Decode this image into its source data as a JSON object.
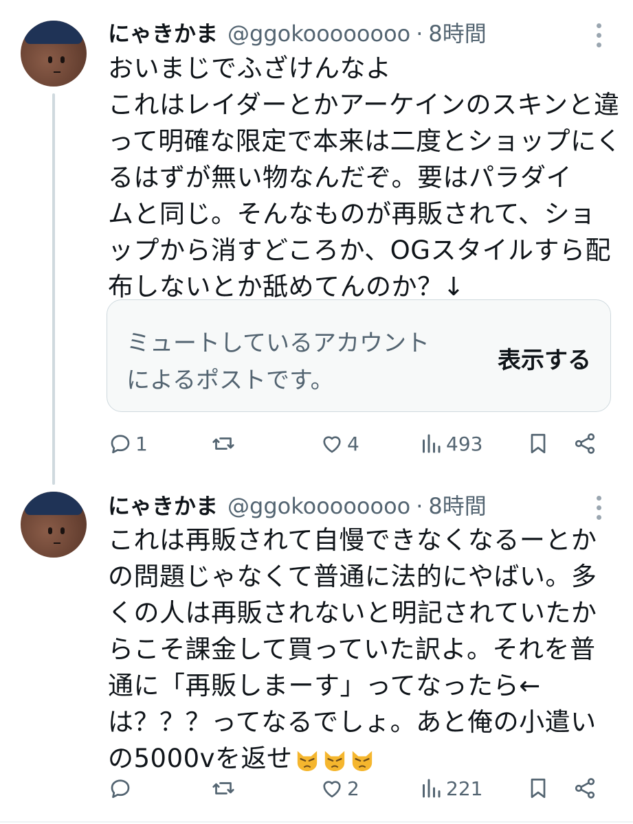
{
  "posts": [
    {
      "name": "にゃきかま",
      "handle": "@ggokoooooooo",
      "separator": "·",
      "time": "8時間",
      "lines": [
        "おいまじでふざけんなよ",
        "これはレイダーとかアーケインのスキンと違",
        "って明確な限定で本来は二度とショップにく",
        "るはずが無い物なんだぞ。要はパラダイ",
        "ムと同じ。そんなものが再販されて、ショ",
        "ップから消すどころか、OGスタイルすら配",
        "布しないとか舐めてんのか？↓"
      ],
      "muted_notice": {
        "line1": "ミュートしているアカウント",
        "line2": "によるポストです。",
        "show_label": "表示する"
      },
      "actions": {
        "replies": "1",
        "reposts": "",
        "likes": "4",
        "views": "493"
      }
    },
    {
      "name": "にゃきかま",
      "handle": "@ggokoooooooo",
      "separator": "·",
      "time": "8時間",
      "lines": [
        "これは再販されて自慢できなくなるーとか",
        "の問題じゃなくて普通に法的にやばい。多",
        "くの人は再販されないと明記されていたか",
        "らこそ課金して買っていた訳よ。それを普",
        "通に「再販しまーす」ってなったら←",
        "は？？？ってなるでしょ。あと俺の小遣い",
        "の5000vを返せ"
      ],
      "emoji": [
        "pouting-cat-emoji",
        "pouting-cat-emoji",
        "pouting-cat-emoji"
      ],
      "actions": {
        "replies": "",
        "reposts": "",
        "likes": "2",
        "views": "221"
      }
    }
  ],
  "icons": {
    "reply": "reply-icon",
    "repost": "repost-icon",
    "like": "heart-icon",
    "views": "views-icon",
    "bookmark": "bookmark-icon",
    "share": "share-icon",
    "more": "more-icon"
  },
  "colors": {
    "text": "#0f1419",
    "secondary": "#536471",
    "line": "#cfd9de"
  }
}
